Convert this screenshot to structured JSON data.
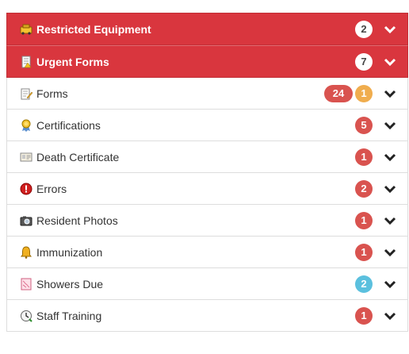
{
  "colors": {
    "alert_header": "#d9363e",
    "badge_red": "#d9534f",
    "badge_orange": "#f0ad4e",
    "badge_blue": "#5bc0de",
    "text": "#333333"
  },
  "items": [
    {
      "label": "Restricted Equipment",
      "icon": "equipment-icon",
      "badges": [
        "2"
      ],
      "style": "alert"
    },
    {
      "label": "Urgent Forms",
      "icon": "urgent-form-icon",
      "badges": [
        "7"
      ],
      "style": "alert"
    },
    {
      "label": "Forms",
      "icon": "form-edit-icon",
      "badges": [
        "24",
        "1"
      ],
      "style": "normal"
    },
    {
      "label": "Certifications",
      "icon": "certificate-ribbon-icon",
      "badges": [
        "5"
      ],
      "style": "normal"
    },
    {
      "label": "Death Certificate",
      "icon": "certificate-card-icon",
      "badges": [
        "1"
      ],
      "style": "normal"
    },
    {
      "label": "Errors",
      "icon": "error-icon",
      "badges": [
        "2"
      ],
      "style": "normal"
    },
    {
      "label": "Resident Photos",
      "icon": "camera-icon",
      "badges": [
        "1"
      ],
      "style": "normal"
    },
    {
      "label": "Immunization",
      "icon": "bell-icon",
      "badges": [
        "1"
      ],
      "style": "normal"
    },
    {
      "label": "Showers Due",
      "icon": "shower-icon",
      "badges": [
        "2"
      ],
      "style": "normal"
    },
    {
      "label": "Staff Training",
      "icon": "clock-icon",
      "badges": [
        "1"
      ],
      "style": "normal"
    }
  ]
}
